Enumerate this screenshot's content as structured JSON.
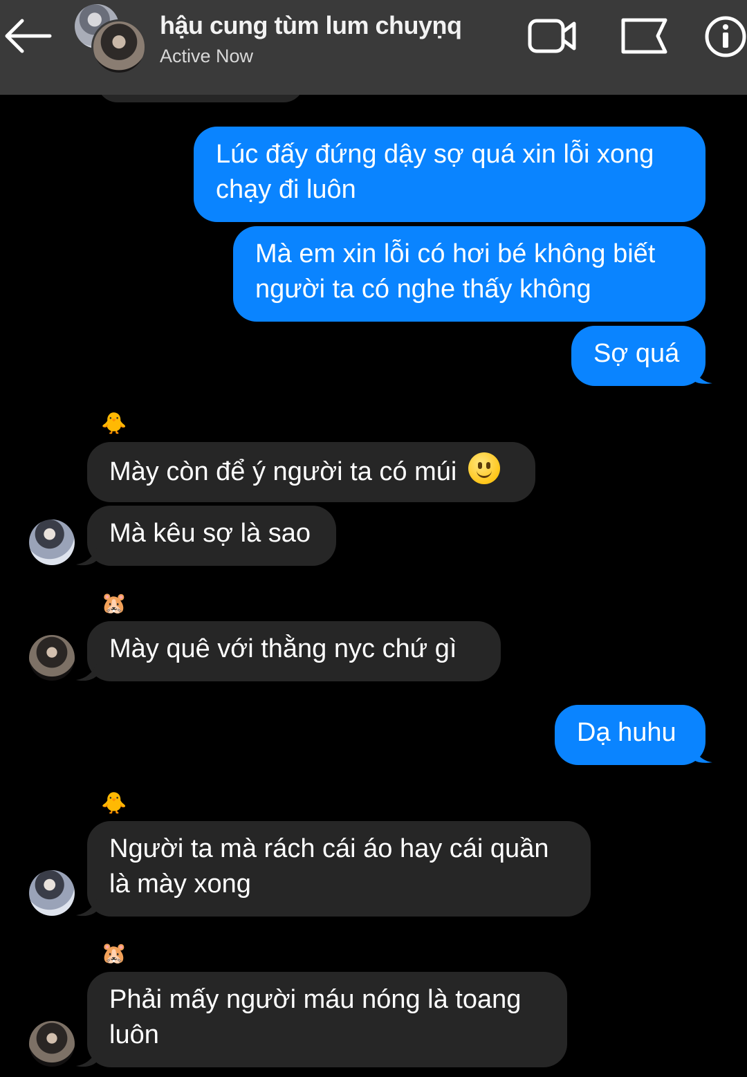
{
  "header": {
    "title": "hậu cung tùm lum chuyṇq",
    "status": "Active Now"
  },
  "messages": {
    "m1": "Lúc đấy đứng dậy sợ quá xin lỗi xong chạy đi luôn",
    "m2": "Mà em xin lỗi có hơi bé không biết người ta có nghe thấy không",
    "m3": "Sợ quá",
    "m4": "Mày còn để ý người ta có múi",
    "m5": "Mà kêu sợ là sao",
    "m6": "Mày quê với thằng nyc chứ gì",
    "m7": "Dạ huhu",
    "m8": "Người ta mà rách cái áo hay cái quần là mày xong",
    "m9": "Phải mấy người máu nóng là toang luôn"
  },
  "reactions": {
    "chick": "🐥",
    "hamster": "🐹"
  },
  "colors": {
    "outgoing": "#0a84ff",
    "incoming": "#262626",
    "header": "#3a3a3a"
  },
  "icons": [
    "back-arrow-icon",
    "video-call-icon",
    "flag-icon",
    "info-icon",
    "slightly-smiling-face-icon"
  ]
}
